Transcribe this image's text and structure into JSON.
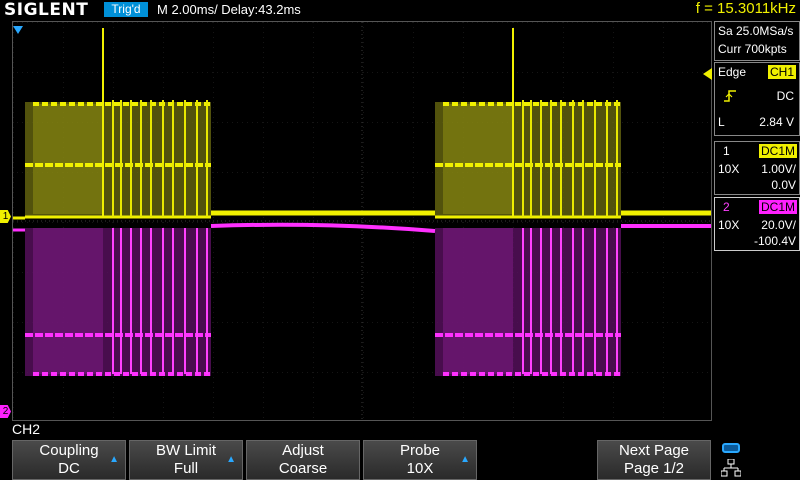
{
  "header": {
    "brand": "SIGLENT",
    "trigger_status": "Trig'd",
    "timebase": "M 2.00ms/ Delay:43.2ms",
    "frequency": "f = 15.3011kHz"
  },
  "acquisition": {
    "sample_rate": "Sa 25.0MSa/s",
    "memory": "Curr 700kpts"
  },
  "trigger": {
    "type": "Edge",
    "source": "CH1",
    "coupling": "DC",
    "slope_icon": "rising-edge-icon",
    "level_label": "L",
    "level": "2.84 V"
  },
  "channels": [
    {
      "num": "1",
      "coupling": "DC1M",
      "probe": "10X",
      "scale": "1.00V/",
      "offset": "0.0V",
      "color": "#f0f000"
    },
    {
      "num": "2",
      "coupling": "DC1M",
      "probe": "10X",
      "scale": "20.0V/",
      "offset": "-100.4V",
      "color": "#ff20ff"
    }
  ],
  "markers": {
    "ch1": "1",
    "ch2": "2"
  },
  "menu": {
    "title": "CH2",
    "items": [
      {
        "label": "Coupling",
        "value": "DC"
      },
      {
        "label": "BW Limit",
        "value": "Full"
      },
      {
        "label": "Adjust",
        "value": "Coarse"
      },
      {
        "label": "Probe",
        "value": "10X"
      },
      {
        "label": "Next Page",
        "value": "Page 1/2"
      }
    ]
  }
}
